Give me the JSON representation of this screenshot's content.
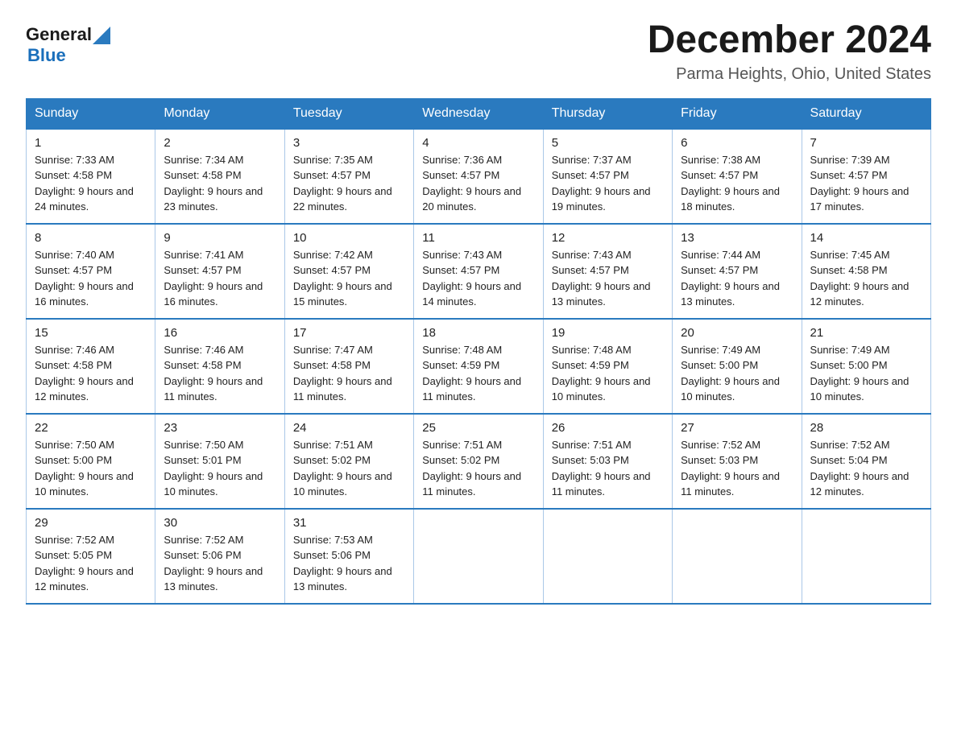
{
  "header": {
    "logo_general": "General",
    "logo_blue": "Blue",
    "month_title": "December 2024",
    "location": "Parma Heights, Ohio, United States"
  },
  "weekdays": [
    "Sunday",
    "Monday",
    "Tuesday",
    "Wednesday",
    "Thursday",
    "Friday",
    "Saturday"
  ],
  "weeks": [
    [
      {
        "day": "1",
        "sunrise": "7:33 AM",
        "sunset": "4:58 PM",
        "daylight": "9 hours and 24 minutes."
      },
      {
        "day": "2",
        "sunrise": "7:34 AM",
        "sunset": "4:58 PM",
        "daylight": "9 hours and 23 minutes."
      },
      {
        "day": "3",
        "sunrise": "7:35 AM",
        "sunset": "4:57 PM",
        "daylight": "9 hours and 22 minutes."
      },
      {
        "day": "4",
        "sunrise": "7:36 AM",
        "sunset": "4:57 PM",
        "daylight": "9 hours and 20 minutes."
      },
      {
        "day": "5",
        "sunrise": "7:37 AM",
        "sunset": "4:57 PM",
        "daylight": "9 hours and 19 minutes."
      },
      {
        "day": "6",
        "sunrise": "7:38 AM",
        "sunset": "4:57 PM",
        "daylight": "9 hours and 18 minutes."
      },
      {
        "day": "7",
        "sunrise": "7:39 AM",
        "sunset": "4:57 PM",
        "daylight": "9 hours and 17 minutes."
      }
    ],
    [
      {
        "day": "8",
        "sunrise": "7:40 AM",
        "sunset": "4:57 PM",
        "daylight": "9 hours and 16 minutes."
      },
      {
        "day": "9",
        "sunrise": "7:41 AM",
        "sunset": "4:57 PM",
        "daylight": "9 hours and 16 minutes."
      },
      {
        "day": "10",
        "sunrise": "7:42 AM",
        "sunset": "4:57 PM",
        "daylight": "9 hours and 15 minutes."
      },
      {
        "day": "11",
        "sunrise": "7:43 AM",
        "sunset": "4:57 PM",
        "daylight": "9 hours and 14 minutes."
      },
      {
        "day": "12",
        "sunrise": "7:43 AM",
        "sunset": "4:57 PM",
        "daylight": "9 hours and 13 minutes."
      },
      {
        "day": "13",
        "sunrise": "7:44 AM",
        "sunset": "4:57 PM",
        "daylight": "9 hours and 13 minutes."
      },
      {
        "day": "14",
        "sunrise": "7:45 AM",
        "sunset": "4:58 PM",
        "daylight": "9 hours and 12 minutes."
      }
    ],
    [
      {
        "day": "15",
        "sunrise": "7:46 AM",
        "sunset": "4:58 PM",
        "daylight": "9 hours and 12 minutes."
      },
      {
        "day": "16",
        "sunrise": "7:46 AM",
        "sunset": "4:58 PM",
        "daylight": "9 hours and 11 minutes."
      },
      {
        "day": "17",
        "sunrise": "7:47 AM",
        "sunset": "4:58 PM",
        "daylight": "9 hours and 11 minutes."
      },
      {
        "day": "18",
        "sunrise": "7:48 AM",
        "sunset": "4:59 PM",
        "daylight": "9 hours and 11 minutes."
      },
      {
        "day": "19",
        "sunrise": "7:48 AM",
        "sunset": "4:59 PM",
        "daylight": "9 hours and 10 minutes."
      },
      {
        "day": "20",
        "sunrise": "7:49 AM",
        "sunset": "5:00 PM",
        "daylight": "9 hours and 10 minutes."
      },
      {
        "day": "21",
        "sunrise": "7:49 AM",
        "sunset": "5:00 PM",
        "daylight": "9 hours and 10 minutes."
      }
    ],
    [
      {
        "day": "22",
        "sunrise": "7:50 AM",
        "sunset": "5:00 PM",
        "daylight": "9 hours and 10 minutes."
      },
      {
        "day": "23",
        "sunrise": "7:50 AM",
        "sunset": "5:01 PM",
        "daylight": "9 hours and 10 minutes."
      },
      {
        "day": "24",
        "sunrise": "7:51 AM",
        "sunset": "5:02 PM",
        "daylight": "9 hours and 10 minutes."
      },
      {
        "day": "25",
        "sunrise": "7:51 AM",
        "sunset": "5:02 PM",
        "daylight": "9 hours and 11 minutes."
      },
      {
        "day": "26",
        "sunrise": "7:51 AM",
        "sunset": "5:03 PM",
        "daylight": "9 hours and 11 minutes."
      },
      {
        "day": "27",
        "sunrise": "7:52 AM",
        "sunset": "5:03 PM",
        "daylight": "9 hours and 11 minutes."
      },
      {
        "day": "28",
        "sunrise": "7:52 AM",
        "sunset": "5:04 PM",
        "daylight": "9 hours and 12 minutes."
      }
    ],
    [
      {
        "day": "29",
        "sunrise": "7:52 AM",
        "sunset": "5:05 PM",
        "daylight": "9 hours and 12 minutes."
      },
      {
        "day": "30",
        "sunrise": "7:52 AM",
        "sunset": "5:06 PM",
        "daylight": "9 hours and 13 minutes."
      },
      {
        "day": "31",
        "sunrise": "7:53 AM",
        "sunset": "5:06 PM",
        "daylight": "9 hours and 13 minutes."
      },
      null,
      null,
      null,
      null
    ]
  ]
}
